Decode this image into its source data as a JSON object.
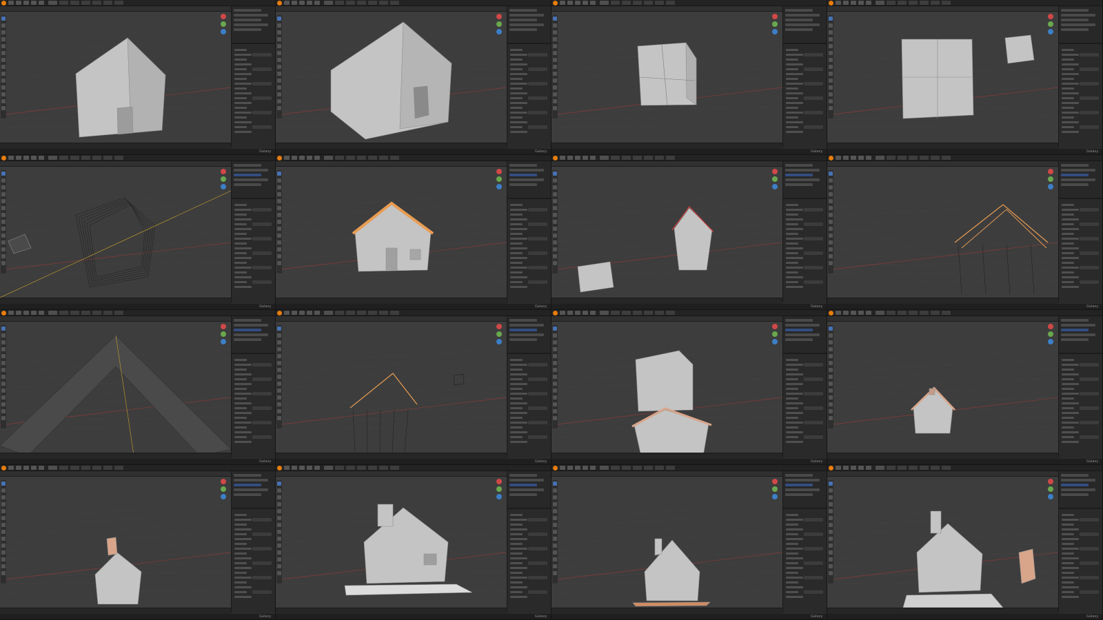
{
  "app": {
    "name": "Blender",
    "icon": "blender-logo-icon",
    "menus": [
      "File",
      "Edit",
      "Render",
      "Window",
      "Help"
    ],
    "workspace_tabs": [
      "Layout",
      "Modeling",
      "Sculpting",
      "UV Editing",
      "Texture Paint",
      "Shading",
      "Animation"
    ],
    "status_label": "Galaxy"
  },
  "colors": {
    "background": "#3d3d3d",
    "mesh": "#c4c4c4",
    "selection": "#e89c52",
    "accent": "#4772b3"
  },
  "panels": [
    {
      "id": 1,
      "view": "Solid",
      "subject": "house-shell-with-door"
    },
    {
      "id": 2,
      "view": "Solid",
      "subject": "house-shell-with-door-closeup"
    },
    {
      "id": 3,
      "view": "Solid",
      "subject": "cube-with-loop-cuts"
    },
    {
      "id": 4,
      "view": "Solid",
      "subject": "large-cube-and-small-cube"
    },
    {
      "id": 5,
      "view": "Wireframe",
      "subject": "house-wireframe"
    },
    {
      "id": 6,
      "view": "Solid",
      "subject": "house-with-roof-selected"
    },
    {
      "id": 7,
      "view": "Solid",
      "subject": "rotated-house-and-cube"
    },
    {
      "id": 8,
      "view": "Wireframe",
      "subject": "house-wireframe-roof-selected"
    },
    {
      "id": 9,
      "view": "Solid",
      "subject": "roof-closeup"
    },
    {
      "id": 10,
      "view": "Wireframe",
      "subject": "house-wireframe-small"
    },
    {
      "id": 11,
      "view": "Solid",
      "subject": "house-with-cube-above"
    },
    {
      "id": 12,
      "view": "Solid",
      "subject": "small-house-with-chimney"
    },
    {
      "id": 13,
      "view": "Solid",
      "subject": "house-with-orange-chimney"
    },
    {
      "id": 14,
      "view": "Solid",
      "subject": "house-on-base-plate"
    },
    {
      "id": 15,
      "view": "Solid",
      "subject": "house-with-chimney-on-plate"
    },
    {
      "id": 16,
      "view": "Solid",
      "subject": "house-with-detached-door"
    }
  ]
}
